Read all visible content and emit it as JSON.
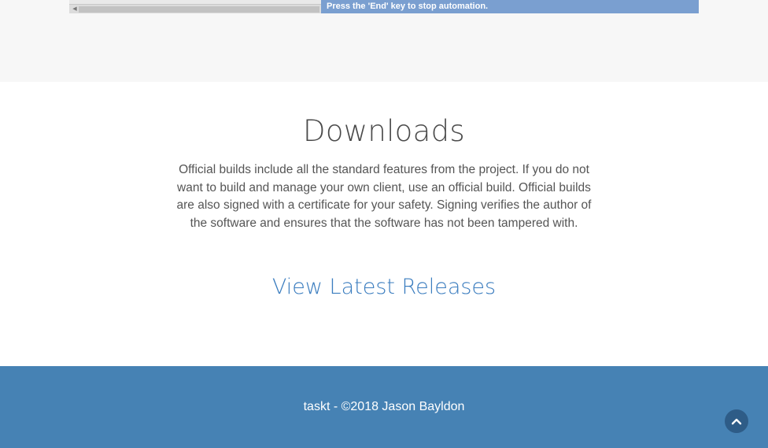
{
  "app_preview": {
    "automation_banner": "Press the 'End' key to stop automation.",
    "scroll_arrow_icon": "scroll-left-arrow-icon"
  },
  "downloads": {
    "title": "Downloads",
    "description": "Official builds include all the standard features from the project. If you do not want to build and manage your own client, use an official build. Official builds are also signed with a certificate for your safety. Signing verifies the author of the software and ensures that the software has not been tampered with.",
    "link_label": "View Latest Releases"
  },
  "footer": {
    "text": "taskt - ©2018 Jason Bayldon"
  },
  "back_to_top_icon": "chevron-up-icon",
  "colors": {
    "footer_bg": "#4682b4",
    "link": "#3b7dbf",
    "banner": "#7a9fd0",
    "back_to_top_bg": "#2e5c87"
  }
}
